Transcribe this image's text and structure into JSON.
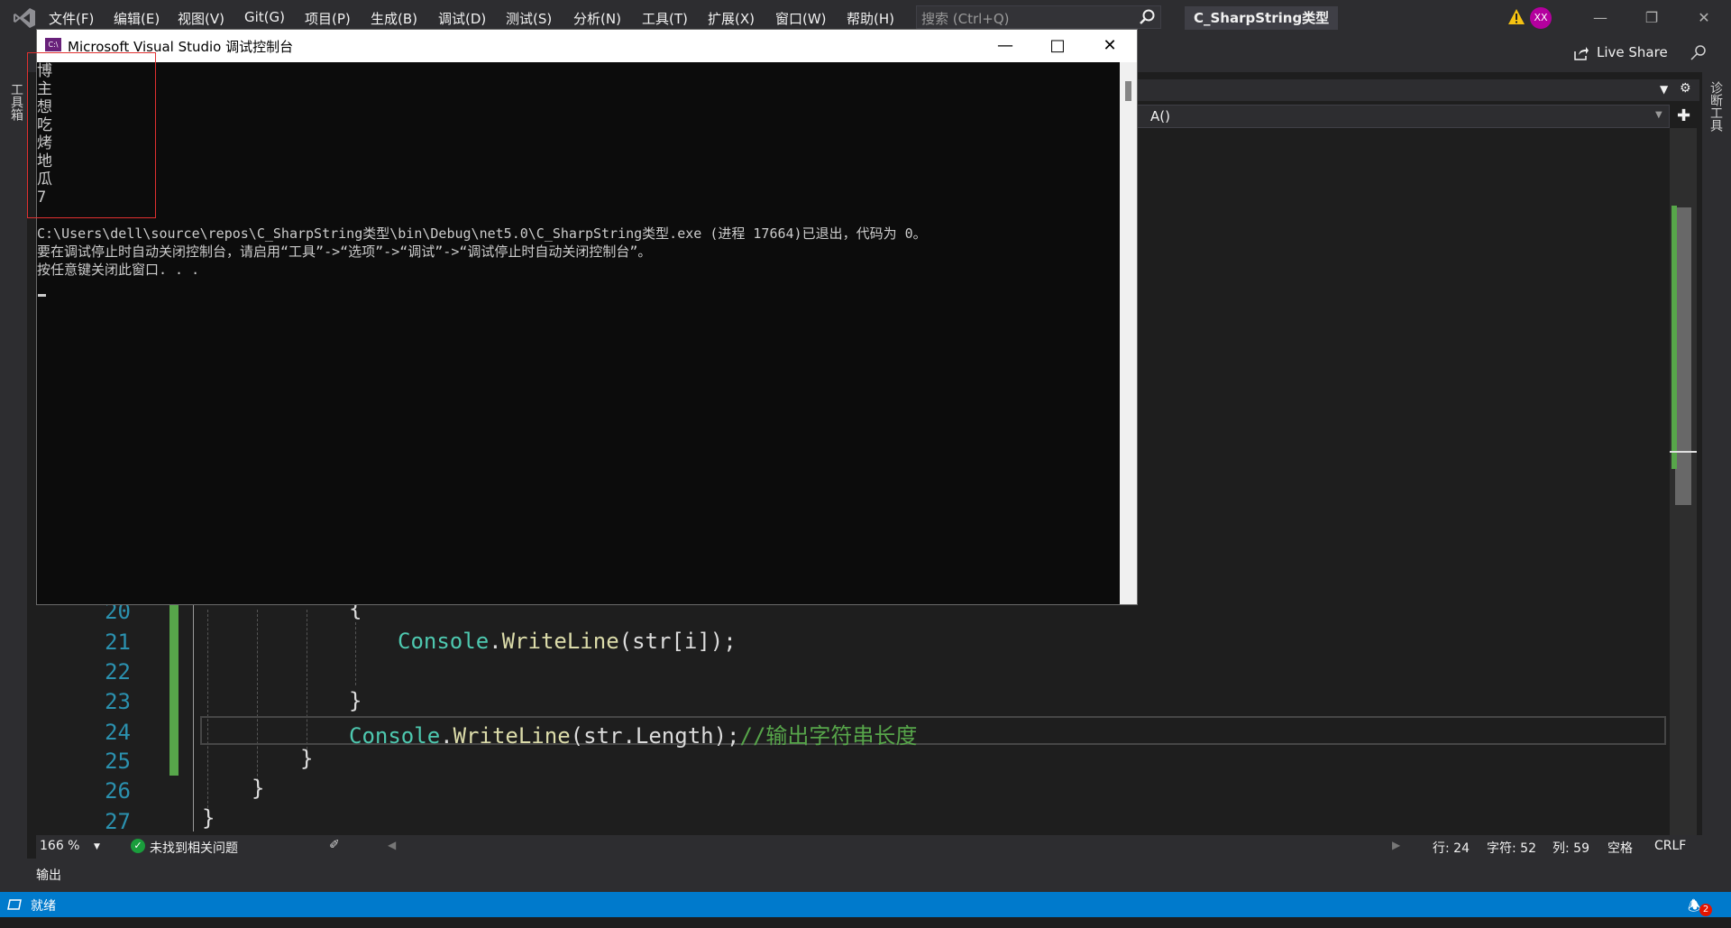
{
  "menubar": {
    "items": [
      "文件(F)",
      "编辑(E)",
      "视图(V)",
      "Git(G)",
      "项目(P)",
      "生成(B)",
      "调试(D)",
      "测试(S)",
      "分析(N)",
      "工具(T)",
      "扩展(X)",
      "窗口(W)",
      "帮助(H)"
    ],
    "search_placeholder": "搜索 (Ctrl+Q)",
    "solution_name": "C_SharpString类型",
    "user_initials": "XX"
  },
  "toolbar": {
    "live_share": "Live Share"
  },
  "side_panels": {
    "left": "工具箱",
    "right": "诊断工具"
  },
  "editor": {
    "nav_member": "A()",
    "line_numbers": [
      "20",
      "21",
      "22",
      "23",
      "24",
      "25",
      "26",
      "27"
    ],
    "code_lines": {
      "l20": "{",
      "l21_class": "Console",
      "l21_method": "WriteLine",
      "l21_rest": "(str[i]);",
      "l23": "}",
      "l24_class": "Console",
      "l24_method": "WriteLine",
      "l24_rest": "(str.Length);",
      "l24_comment": "//输出字符串长度",
      "l25": "}",
      "l26": "}",
      "l27": "}"
    }
  },
  "editor_status": {
    "zoom": "166 %",
    "issues": "未找到相关问题",
    "line": "行: 24",
    "char": "字符: 52",
    "col": "列: 59",
    "whitespace": "空格",
    "eol": "CRLF"
  },
  "output_panel": {
    "label": "输出"
  },
  "statusbar": {
    "ready": "就绪",
    "notifications": "2"
  },
  "console": {
    "title": "Microsoft Visual Studio 调试控制台",
    "icon_text": "C:\\",
    "output_lines": [
      "博",
      "主",
      "想",
      "吃",
      "烤",
      "地",
      "瓜",
      "7",
      "",
      "C:\\Users\\dell\\source\\repos\\C_SharpString类型\\bin\\Debug\\net5.0\\C_SharpString类型.exe (进程 17664)已退出，代码为 0。",
      "要在调试停止时自动关闭控制台，请启用“工具”->“选项”->“调试”->“调试停止时自动关闭控制台”。",
      "按任意键关闭此窗口. . ."
    ]
  },
  "colors": {
    "accent": "#007acc",
    "chrome": "#2d2d30",
    "editor_bg": "#1e1e1e",
    "class": "#4ec9b0",
    "method": "#dcdcaa",
    "comment": "#57a64a",
    "line_number": "#2b91af"
  }
}
